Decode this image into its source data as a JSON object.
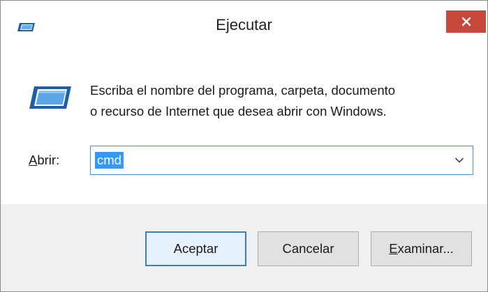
{
  "window": {
    "title": "Ejecutar",
    "icons": {
      "title": "run-dialog-icon",
      "close": "close-icon"
    },
    "colors": {
      "close_bg": "#c7473b",
      "focus_border": "#4e8fd6",
      "selection": "#3399ff"
    }
  },
  "content": {
    "icon": "run-program-icon",
    "description_line1": "Escriba el nombre del programa, carpeta, documento",
    "description_line2": "o recurso de Internet que desea abrir con Windows.",
    "open_label_mnemonic": "A",
    "open_label_rest": "brir:",
    "input_value": "cmd",
    "dropdown_icon": "chevron-down-icon"
  },
  "buttons": {
    "ok": "Aceptar",
    "cancel": "Cancelar",
    "browse_mnemonic": "E",
    "browse_rest": "xaminar..."
  }
}
